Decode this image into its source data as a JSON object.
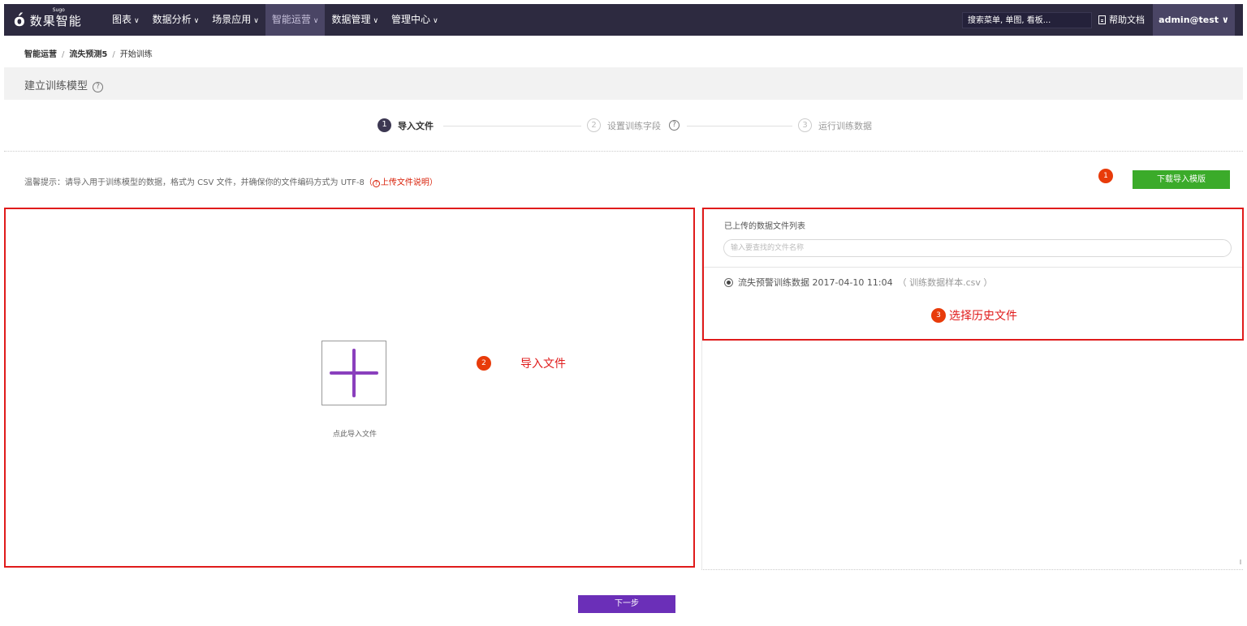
{
  "brand": {
    "logo_mark": "ó",
    "logo_text": "数果智能",
    "logo_small": "Sugo"
  },
  "nav": {
    "items": [
      {
        "label": "图表"
      },
      {
        "label": "数据分析"
      },
      {
        "label": "场景应用"
      },
      {
        "label": "智能运营",
        "active": true
      },
      {
        "label": "数据管理"
      },
      {
        "label": "管理中心"
      }
    ],
    "caret": "∨",
    "search_placeholder": "搜索菜单, 单图, 看板...",
    "help_label": "帮助文档",
    "user_label": "admin@test ∨"
  },
  "breadcrumb": {
    "items": [
      "智能运营",
      "流失预测5",
      "开始训练"
    ],
    "separator": "/"
  },
  "page": {
    "title": "建立训练模型",
    "title_help": "?"
  },
  "steps": [
    {
      "num": "1",
      "label": "导入文件",
      "active": true
    },
    {
      "num": "2",
      "label": "设置训练字段",
      "active": false,
      "help": "?"
    },
    {
      "num": "3",
      "label": "运行训练数据",
      "active": false
    }
  ],
  "tip": {
    "prefix": "温馨提示：请导入用于训练模型的数据，格式为 CSV 文件，并确保你的文件编码方式为 UTF-8",
    "open_paren": "（",
    "help_mark": "?",
    "link": "上传文件说明",
    "close_paren": "）"
  },
  "annotations": {
    "badge_1": "1",
    "badge_2": "2",
    "badge_3": "3",
    "label_2": "导入文件",
    "label_3": "选择历史文件"
  },
  "download_button": "下载导入模版",
  "upload": {
    "text": "点此导入文件"
  },
  "file_panel": {
    "title": "已上传的数据文件列表",
    "search_placeholder": "输入要查找的文件名称",
    "files": [
      {
        "name": "流失预警训练数据 2017-04-10 11:04",
        "source": "（ 训练数据样本.csv ）",
        "selected": true
      }
    ]
  },
  "next_button": "下一步",
  "colors": {
    "nav_bg": "#2d2a40",
    "accent_purple": "#6b2fb8",
    "download_green": "#3bab2a",
    "annotation_red": "#e01b1b"
  }
}
